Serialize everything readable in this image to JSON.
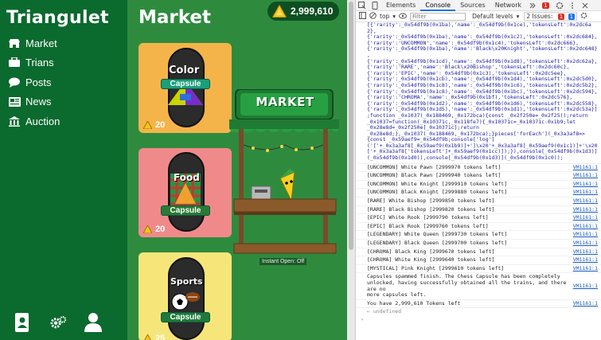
{
  "sidebar": {
    "brand": "Triangulet",
    "nav": [
      {
        "label": "Market",
        "icon": "store-icon"
      },
      {
        "label": "Trians",
        "icon": "briefcase-icon"
      },
      {
        "label": "Posts",
        "icon": "chat-icon"
      },
      {
        "label": "News",
        "icon": "news-icon"
      },
      {
        "label": "Auction",
        "icon": "bank-icon"
      }
    ],
    "bottom_icons": [
      "contacts-icon",
      "settings-icon",
      "profile-icon"
    ]
  },
  "market": {
    "title": "Market",
    "tokens": "2,999,610",
    "stand_sign": "MARKET",
    "instant_open_label": "Instant Open: Off",
    "capsules": [
      {
        "name": "Color",
        "band": "Capsule",
        "price": "20",
        "bg": "#f4b44a"
      },
      {
        "name": "Food",
        "band": "Capsule",
        "price": "20",
        "bg": "#f08a8a"
      },
      {
        "name": "Sports",
        "band": "Capsule",
        "price": "25",
        "bg": "#f6e67a"
      }
    ]
  },
  "devtools": {
    "tabs": [
      "Elements",
      "Console",
      "Sources",
      "Network"
    ],
    "active_tab": "Console",
    "error_count": "1",
    "issues_label": "2 Issues:",
    "issues_count": "1",
    "extra_count": "1",
    "context": "top",
    "filter_placeholder": "Filter",
    "levels": "Default levels",
    "code": "[{'rarity':_0x54df9b(0x1ba),'name':_0x54df9b(0x1ce),'tokensLeft':0x2dc6a2},\n{'rarity':_0x54df9b(0x1ba),'name':_0x54df9b(0x1c2),'tokensLeft':0x2dc684},\n{'rarity':'UNCOMMON','name':_0x54df9b(0x1c4),'tokensLeft':0x2dc666},\n{'rarity':_0x54df9b(0x1ba),'name':'Black\\x20Knight','tokensLeft':0x2dc648}\n,\n{'rarity':_0x54df9b(0x1cd),'name':_0x54df9b(0x1d8),'tokensLeft':0x2dc62a},\n{'rarity':'RARE','name':'Black\\x20Bishop','tokensLeft':0x2dc60c},\n{'rarity':'EPIC','name':_0x54df9b(0x1c3),'tokensLeft':0x2dc5ee},\n{'rarity':_0x54df9b(0x1cb),'name':_0x54df9b(0x1d4),'tokensLeft':0x2dc5d0},\n{'rarity':_0x54df9b(0x1c8),'name':_0x54df9b(0x1c6),'tokensLeft':0x2dc5b2},\n{'rarity':_0x54df9b(0x1c8),'name':_0x54df9b(0x1bc),'tokensLeft':0x2dc594},\n{'rarity':'CHROMA','name':_0x54df9b(0x1bf),'tokensLeft':0x2dc576},\n{'rarity':_0x54df9b(0x1d2),'name':_0x54df9b(0x1d6),'tokensLeft':0x2dc558},\n{'rarity':_0x54df9b(0x1d5),'name':_0x54df9b(0x1d1),'tokensLeft':0x2dc53a}]\n;function _0x1037(_0x188469,_0x172bca){const _0x2f250e=_0x2f25();return\n_0x1037=function(_0x10371c,_0x118fe7){_0x10371c=_0x10371c-0x1b9;let\n_0x28e8d=_0x2f250e[_0x10371c];return\n_0x28e8d;},_0x1037(_0x188469,_0x172bca);}pieces['forEach'](_0x3a3af8=>\n{const _0x59aef9=_0x54df9b;console['log']\n('['+_0x3a3af8[_0x59aef9(0x1b9)]+']\\x20'+_0x3a3af8[_0x59aef9(0x1c1)]+'\\x20\n['+_0x3a3af8['tokensLeft']+_0x59aef9(0x1cc)]);}),console[_0x54df9b(0x1d3)]\n(_0x54df9b(0x1d0)),console[_0x54df9b(0x1d3)](_0x54df9b(0x1c0));",
    "logs": [
      {
        "msg": "[UNCOMMON] White Pawn [2999970 tokens left]",
        "src": "VM1161:1"
      },
      {
        "msg": "[UNCOMMON] Black Pawn [2999940 tokens left]",
        "src": "VM1161:1"
      },
      {
        "msg": "[UNCOMMON] White Knight [2999910 tokens left]",
        "src": "VM1161:1"
      },
      {
        "msg": "[UNCOMMON] Black Knight [2999880 tokens left]",
        "src": "VM1161:1"
      },
      {
        "msg": "[RARE] White Bishop [2999850 tokens left]",
        "src": "VM1161:1"
      },
      {
        "msg": "[RARE] Black Bishop [2999820 tokens left]",
        "src": "VM1161:1"
      },
      {
        "msg": "[EPIC] White Rook [2999790 tokens left]",
        "src": "VM1161:1"
      },
      {
        "msg": "[EPIC] Black Rook [2999760 tokens left]",
        "src": "VM1161:1"
      },
      {
        "msg": "[LEGENDARY] White Queen [2999730 tokens left]",
        "src": "VM1161:1"
      },
      {
        "msg": "[LEGENDARY] Black Queen [2999700 tokens left]",
        "src": "VM1161:1"
      },
      {
        "msg": "[CHROMA] Black King [2999670 tokens left]",
        "src": "VM1161:1"
      },
      {
        "msg": "[CHROMA] White King [2999640 tokens left]",
        "src": "VM1161:1"
      },
      {
        "msg": "[MYSTICAL] Pink Knight [2999610 tokens left]",
        "src": "VM1161:1"
      },
      {
        "msg": "Capsules spammed finish. The Chess Capsule has been completely\nunlocked, having successfully obtained all the trains, and there are no\nmore capsules left.",
        "src": "VM1161:1"
      },
      {
        "msg": "You have 2,999,610 Tokens left",
        "src": "VM1161:1"
      }
    ],
    "result": "undefined"
  }
}
